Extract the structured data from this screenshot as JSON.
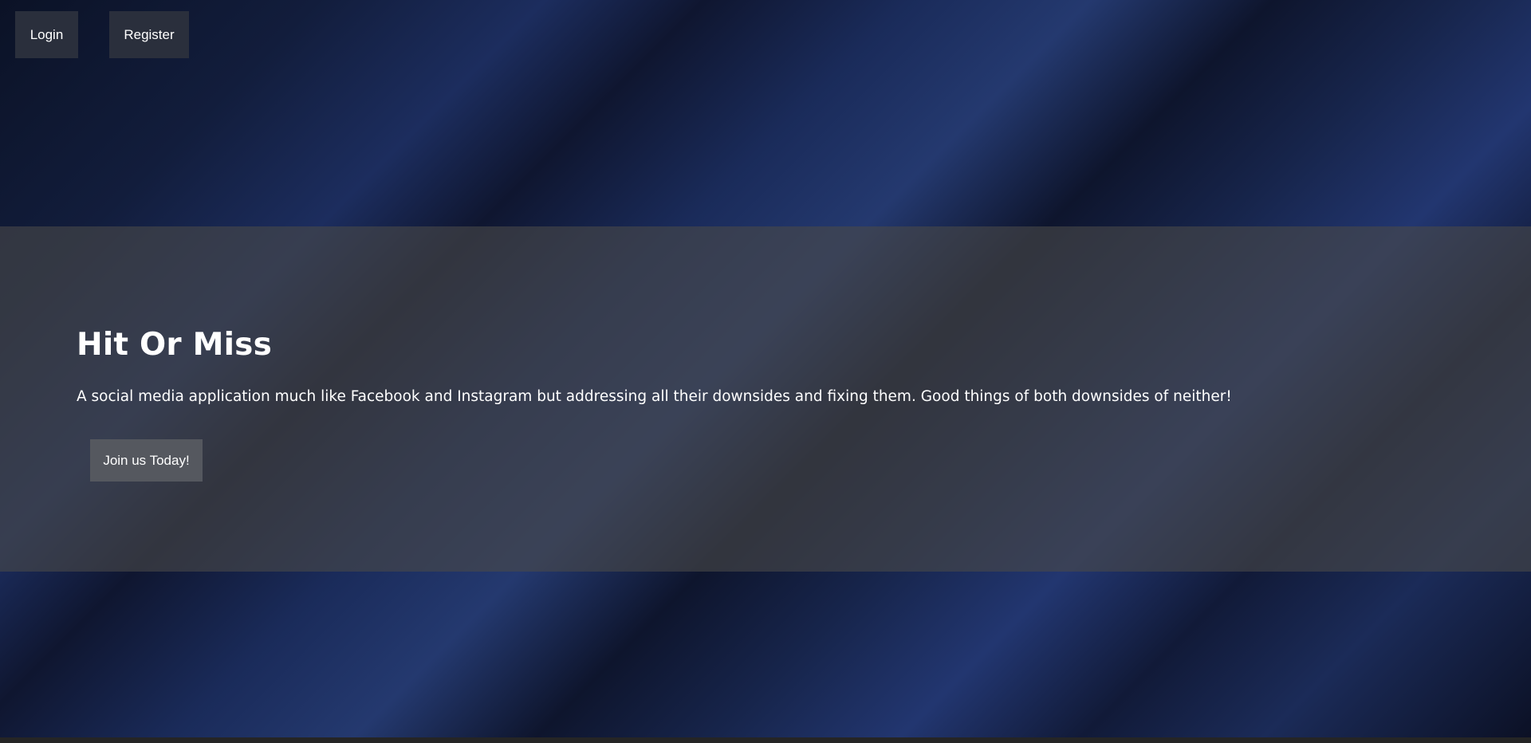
{
  "nav": {
    "login_label": "Login",
    "register_label": "Register"
  },
  "hero": {
    "title": "Hit Or Miss",
    "description": "A social media application much like Facebook and Instagram but addressing all their downsides and fixing them. Good things of both downsides of neither!",
    "cta_label": "Join us Today!"
  },
  "colors": {
    "background_dark": "#0b1226",
    "background_blue": "#24396f",
    "nav_button_bg": "#2a2f3c",
    "hero_overlay": "#484848",
    "cta_button_bg": "#55585f",
    "text": "#ffffff"
  }
}
